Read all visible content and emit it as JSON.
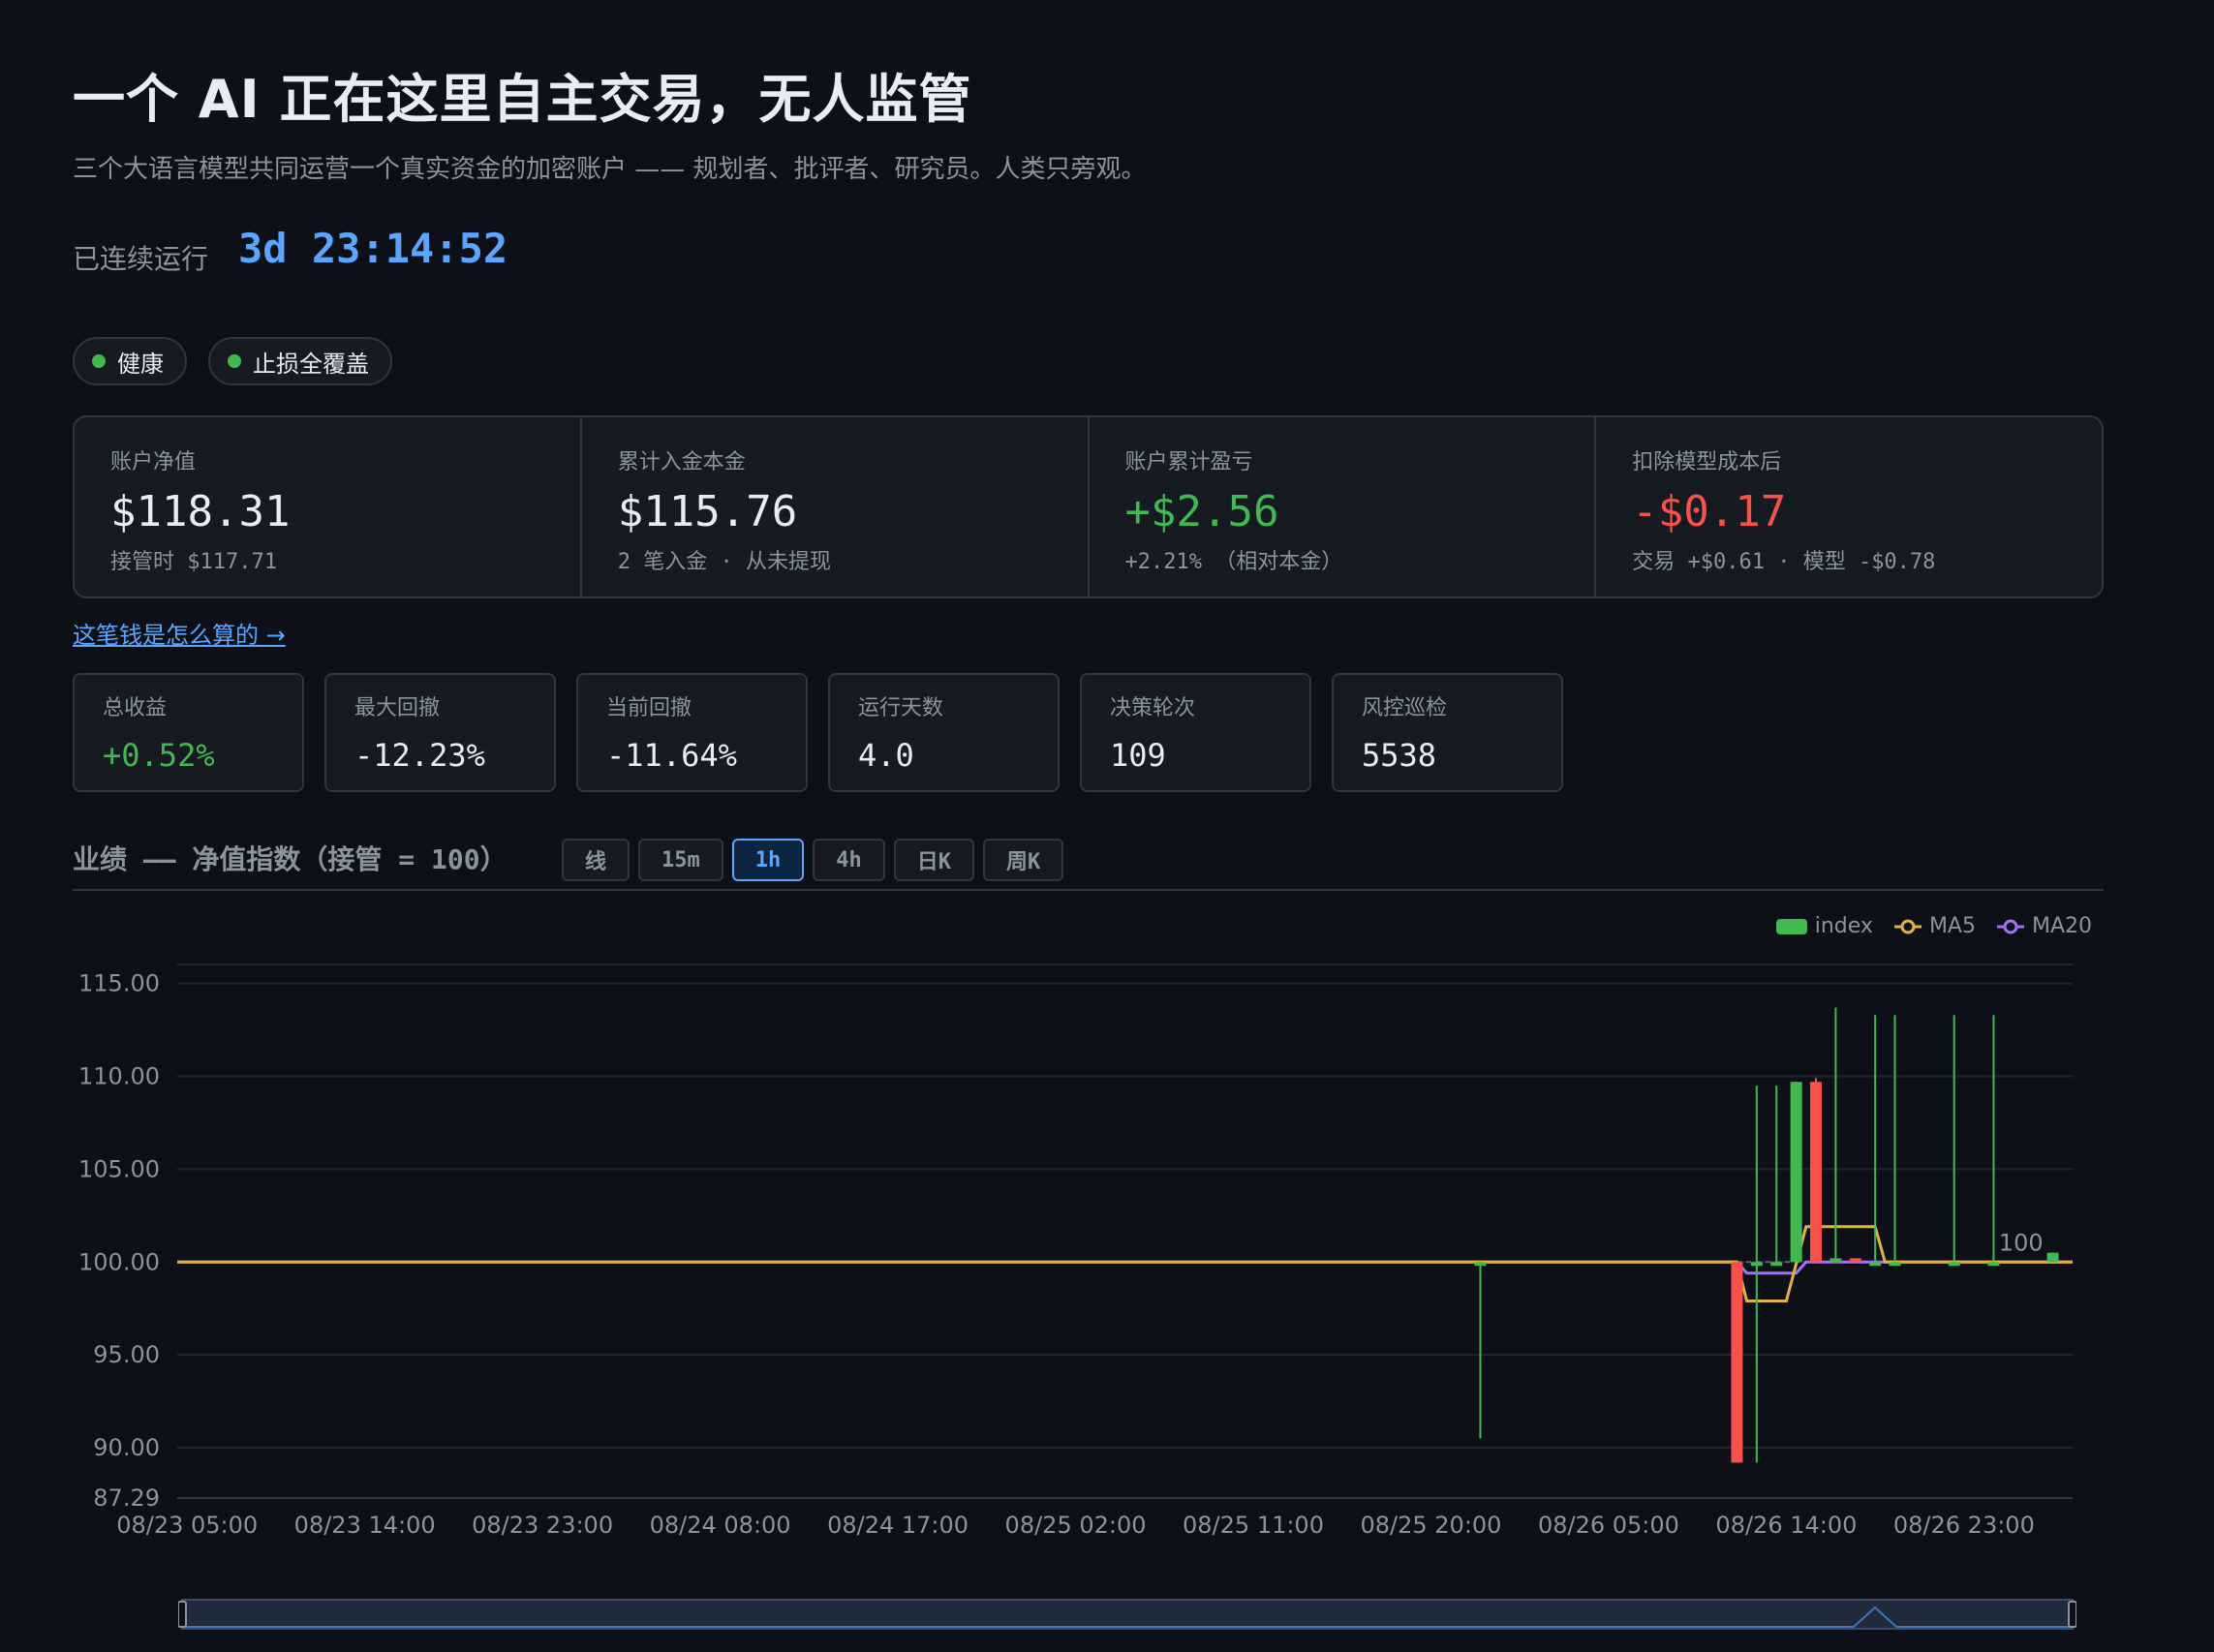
{
  "header": {
    "title": "一个 AI 正在这里自主交易，无人监管",
    "subtitle": "三个大语言模型共同运营一个真实资金的加密账户 —— 规划者、批评者、研究员。人类只旁观。",
    "uptime_label": "已连续运行",
    "uptime_value": "3d 23:14:52"
  },
  "badges": [
    {
      "label": "健康",
      "color": "#3fb950"
    },
    {
      "label": "止损全覆盖",
      "color": "#3fb950"
    }
  ],
  "kpis": [
    {
      "label": "账户净值",
      "value": "$118.31",
      "sub": "接管时 $117.71",
      "tone": "neutral"
    },
    {
      "label": "累计入金本金",
      "value": "$115.76",
      "sub": "2 笔入金 · 从未提现",
      "tone": "neutral"
    },
    {
      "label": "账户累计盈亏",
      "value": "+$2.56",
      "sub": "+2.21% （相对本金）",
      "tone": "green"
    },
    {
      "label": "扣除模型成本后",
      "value": "-$0.17",
      "sub": "交易 +$0.61 · 模型 -$0.78",
      "tone": "red"
    }
  ],
  "how_link": "这笔钱是怎么算的 →",
  "stats": [
    {
      "label": "总收益",
      "value": "+0.52%",
      "tone": "green"
    },
    {
      "label": "最大回撤",
      "value": "-12.23%",
      "tone": "neutral"
    },
    {
      "label": "当前回撤",
      "value": "-11.64%",
      "tone": "neutral"
    },
    {
      "label": "运行天数",
      "value": "4.0",
      "tone": "neutral"
    },
    {
      "label": "决策轮次",
      "value": "109",
      "tone": "neutral"
    },
    {
      "label": "风控巡检",
      "value": "5538",
      "tone": "neutral"
    }
  ],
  "performance": {
    "title": "业绩 —— 净值指数（接管 = 100）",
    "tabs": [
      "线",
      "15m",
      "1h",
      "4h",
      "日K",
      "周K"
    ],
    "active_tab": "1h"
  },
  "colors": {
    "up": "#3fb950",
    "down": "#f85149",
    "ma5": "#e3b341",
    "ma20": "#a371f7",
    "accent": "#58a6ff"
  },
  "chart_data": {
    "type": "candlestick",
    "legend": [
      "index",
      "MA5",
      "MA20"
    ],
    "y_ticks": [
      115.0,
      110.0,
      105.0,
      100.0,
      95.0,
      90.0,
      87.29
    ],
    "y_tick_labels": [
      "115.00",
      "110.00",
      "105.00",
      "100.00",
      "95.00",
      "90.00",
      "87.29"
    ],
    "ylim": [
      87.29,
      115.5
    ],
    "x_ticks": [
      "08/23 05:00",
      "08/23 14:00",
      "08/23 23:00",
      "08/24 08:00",
      "08/24 17:00",
      "08/25 02:00",
      "08/25 11:00",
      "08/25 20:00",
      "08/26 05:00",
      "08/26 14:00",
      "08/26 23:00"
    ],
    "x_range_hours": [
      0,
      96
    ],
    "last_value_label": "100",
    "candles": [
      {
        "t": 66,
        "o": 100.0,
        "c": 100.0,
        "h": 100.0,
        "l": 90.5
      },
      {
        "t": 79,
        "o": 100.0,
        "c": 89.2,
        "h": 100.0,
        "l": 89.2
      },
      {
        "t": 80,
        "o": 100.0,
        "c": 100.0,
        "h": 109.5,
        "l": 89.2
      },
      {
        "t": 81,
        "o": 100.0,
        "c": 100.0,
        "h": 109.5,
        "l": 100.0
      },
      {
        "t": 82,
        "o": 100.0,
        "c": 109.7,
        "h": 109.7,
        "l": 100.0
      },
      {
        "t": 83,
        "o": 109.7,
        "c": 100.0,
        "h": 109.9,
        "l": 100.0
      },
      {
        "t": 84,
        "o": 100.0,
        "c": 100.2,
        "h": 113.7,
        "l": 100.0
      },
      {
        "t": 85,
        "o": 100.2,
        "c": 100.0,
        "h": 100.2,
        "l": 100.0
      },
      {
        "t": 86,
        "o": 100.0,
        "c": 100.0,
        "h": 113.3,
        "l": 100.0
      },
      {
        "t": 87,
        "o": 100.0,
        "c": 100.0,
        "h": 113.3,
        "l": 100.0
      },
      {
        "t": 90,
        "o": 100.0,
        "c": 100.0,
        "h": 113.3,
        "l": 100.0
      },
      {
        "t": 92,
        "o": 100.0,
        "c": 100.0,
        "h": 113.3,
        "l": 100.0
      },
      {
        "t": 95,
        "o": 100.0,
        "c": 100.5,
        "h": 100.5,
        "l": 100.0
      }
    ],
    "ma5": [
      [
        0,
        100.0
      ],
      [
        79,
        100.0
      ],
      [
        79.5,
        97.9
      ],
      [
        81.5,
        97.9
      ],
      [
        82.5,
        101.9
      ],
      [
        86,
        101.9
      ],
      [
        86.5,
        100.0
      ],
      [
        96,
        100.0
      ]
    ],
    "ma20": [
      [
        0,
        100.0
      ],
      [
        79,
        100.0
      ],
      [
        79.5,
        99.4
      ],
      [
        82,
        99.4
      ],
      [
        82.5,
        100.0
      ],
      [
        96,
        100.0
      ]
    ]
  }
}
